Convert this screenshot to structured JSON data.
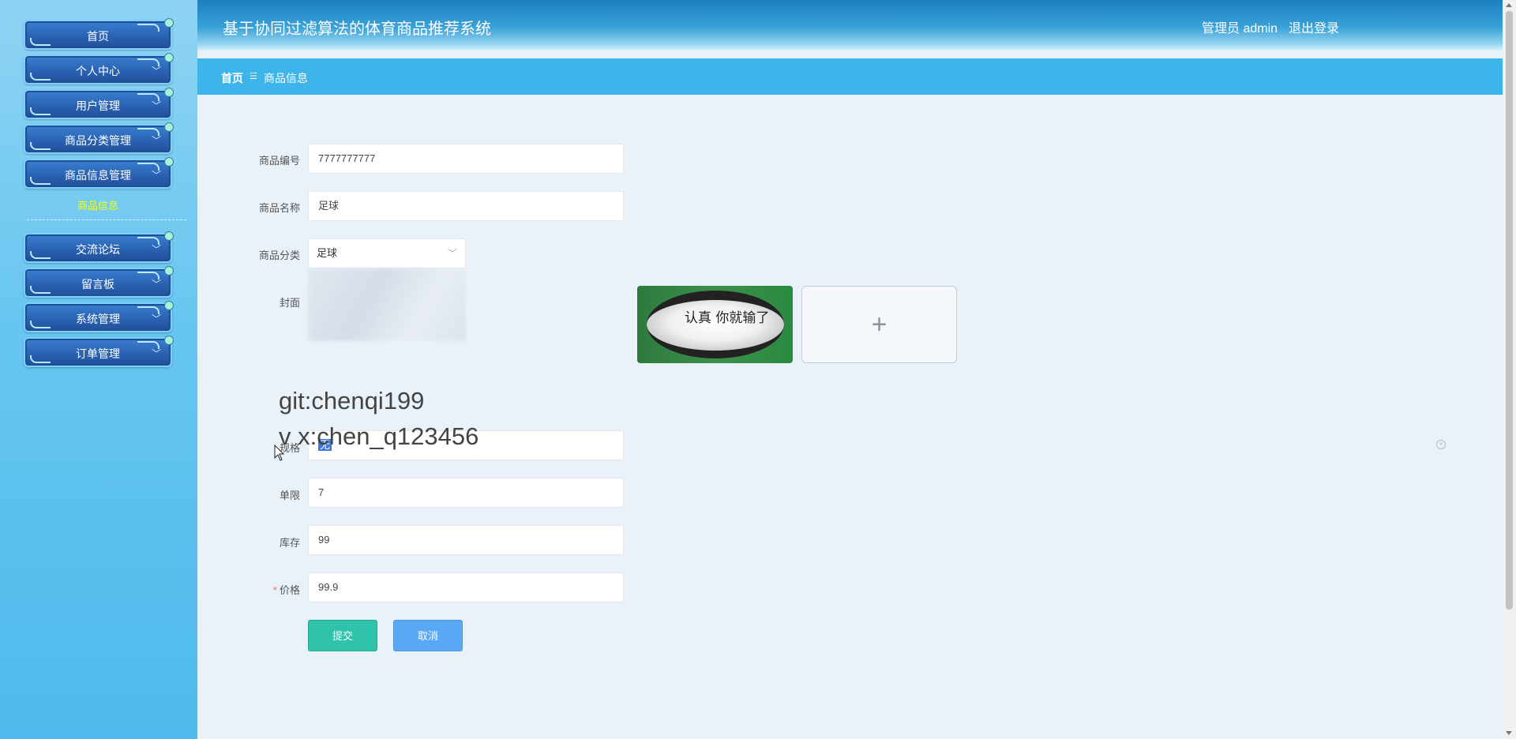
{
  "header": {
    "title": "基于协同过滤算法的体育商品推荐系统",
    "admin_label": "管理员 admin",
    "logout_label": "退出登录"
  },
  "breadcrumb": {
    "home": "首页",
    "separator": "☰",
    "current": "商品信息"
  },
  "sidebar": {
    "items": [
      {
        "label": "首页"
      },
      {
        "label": "个人中心"
      },
      {
        "label": "用户管理"
      },
      {
        "label": "商品分类管理"
      },
      {
        "label": "商品信息管理"
      },
      {
        "label": "交流论坛"
      },
      {
        "label": "留言板"
      },
      {
        "label": "系统管理"
      },
      {
        "label": "订单管理"
      }
    ],
    "active_sub": "商品信息"
  },
  "form": {
    "code_label": "商品编号",
    "code_value": "7777777777",
    "name_label": "商品名称",
    "name_value": "足球",
    "category_label": "商品分类",
    "category_value": "足球",
    "cover_label": "封面",
    "cover_image_text": "认真 你就输了",
    "spec_label": "规格",
    "spec_value": "无",
    "limit_label": "单限",
    "limit_value": "7",
    "stock_label": "库存",
    "stock_value": "99",
    "price_label": "价格",
    "price_value": "99.9",
    "required_mark": "*",
    "submit_label": "提交",
    "cancel_label": "取消"
  },
  "watermark": {
    "line1": "git:chenqi199",
    "line2": "v x:chen_q123456"
  },
  "icons": {
    "plus": "+",
    "chevron": "﹀",
    "clear": "×"
  }
}
